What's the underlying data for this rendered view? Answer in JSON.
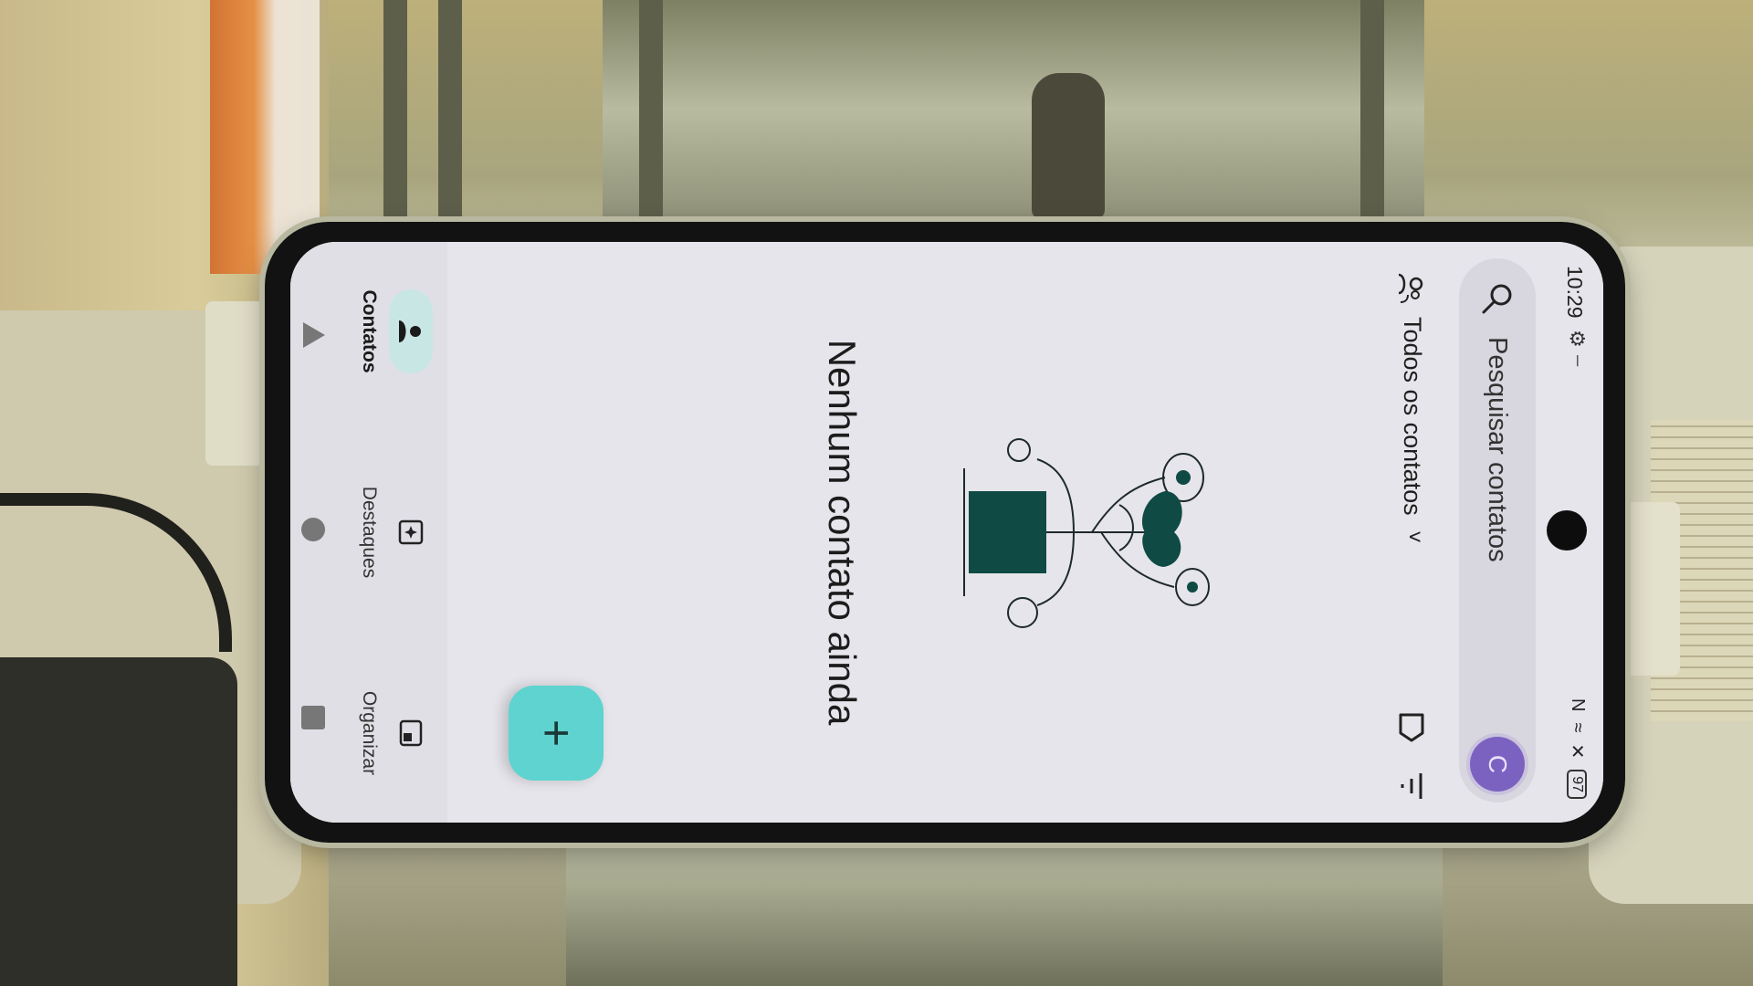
{
  "status_bar": {
    "time": "10:29",
    "settings_glyph": "⚙",
    "dash": "–",
    "nfc": "N",
    "wifi": "≈",
    "battery": "97"
  },
  "search": {
    "placeholder": "Pesquisar contatos",
    "avatar_letter": "C"
  },
  "filter": {
    "label": "Todos os contatos",
    "chevron": "˅"
  },
  "empty_state": {
    "message": "Nenhum contato ainda"
  },
  "fab": {
    "label": "+"
  },
  "nav": {
    "items": [
      {
        "label": "Contatos",
        "icon": "person-icon",
        "active": true
      },
      {
        "label": "Destaques",
        "icon": "sparkle-icon",
        "active": false
      },
      {
        "label": "Organizar",
        "icon": "organize-icon",
        "active": false
      }
    ]
  },
  "colors": {
    "fab": "#5fd3cf",
    "avatar": "#7c62c0",
    "active_pill": "#c8e7e4",
    "illustration": "#0f4a44"
  }
}
